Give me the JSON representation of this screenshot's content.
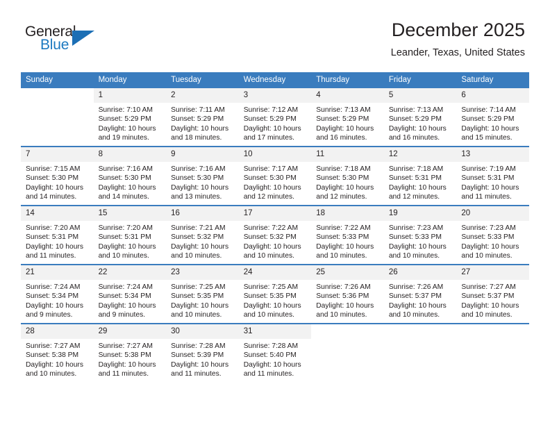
{
  "brand": {
    "name_part1": "General",
    "name_part2": "Blue",
    "accent_color": "#1c79c0"
  },
  "header": {
    "month_title": "December 2025",
    "location": "Leander, Texas, United States"
  },
  "calendar": {
    "header_background": "#3a7cbe",
    "daynum_background": "#f2f2f2",
    "weekdays": [
      "Sunday",
      "Monday",
      "Tuesday",
      "Wednesday",
      "Thursday",
      "Friday",
      "Saturday"
    ],
    "weeks": [
      [
        {
          "day": "",
          "sunrise": "",
          "sunset": "",
          "daylight_line1": "",
          "daylight_line2": ""
        },
        {
          "day": "1",
          "sunrise": "Sunrise: 7:10 AM",
          "sunset": "Sunset: 5:29 PM",
          "daylight_line1": "Daylight: 10 hours",
          "daylight_line2": "and 19 minutes."
        },
        {
          "day": "2",
          "sunrise": "Sunrise: 7:11 AM",
          "sunset": "Sunset: 5:29 PM",
          "daylight_line1": "Daylight: 10 hours",
          "daylight_line2": "and 18 minutes."
        },
        {
          "day": "3",
          "sunrise": "Sunrise: 7:12 AM",
          "sunset": "Sunset: 5:29 PM",
          "daylight_line1": "Daylight: 10 hours",
          "daylight_line2": "and 17 minutes."
        },
        {
          "day": "4",
          "sunrise": "Sunrise: 7:13 AM",
          "sunset": "Sunset: 5:29 PM",
          "daylight_line1": "Daylight: 10 hours",
          "daylight_line2": "and 16 minutes."
        },
        {
          "day": "5",
          "sunrise": "Sunrise: 7:13 AM",
          "sunset": "Sunset: 5:29 PM",
          "daylight_line1": "Daylight: 10 hours",
          "daylight_line2": "and 16 minutes."
        },
        {
          "day": "6",
          "sunrise": "Sunrise: 7:14 AM",
          "sunset": "Sunset: 5:29 PM",
          "daylight_line1": "Daylight: 10 hours",
          "daylight_line2": "and 15 minutes."
        }
      ],
      [
        {
          "day": "7",
          "sunrise": "Sunrise: 7:15 AM",
          "sunset": "Sunset: 5:30 PM",
          "daylight_line1": "Daylight: 10 hours",
          "daylight_line2": "and 14 minutes."
        },
        {
          "day": "8",
          "sunrise": "Sunrise: 7:16 AM",
          "sunset": "Sunset: 5:30 PM",
          "daylight_line1": "Daylight: 10 hours",
          "daylight_line2": "and 14 minutes."
        },
        {
          "day": "9",
          "sunrise": "Sunrise: 7:16 AM",
          "sunset": "Sunset: 5:30 PM",
          "daylight_line1": "Daylight: 10 hours",
          "daylight_line2": "and 13 minutes."
        },
        {
          "day": "10",
          "sunrise": "Sunrise: 7:17 AM",
          "sunset": "Sunset: 5:30 PM",
          "daylight_line1": "Daylight: 10 hours",
          "daylight_line2": "and 12 minutes."
        },
        {
          "day": "11",
          "sunrise": "Sunrise: 7:18 AM",
          "sunset": "Sunset: 5:30 PM",
          "daylight_line1": "Daylight: 10 hours",
          "daylight_line2": "and 12 minutes."
        },
        {
          "day": "12",
          "sunrise": "Sunrise: 7:18 AM",
          "sunset": "Sunset: 5:31 PM",
          "daylight_line1": "Daylight: 10 hours",
          "daylight_line2": "and 12 minutes."
        },
        {
          "day": "13",
          "sunrise": "Sunrise: 7:19 AM",
          "sunset": "Sunset: 5:31 PM",
          "daylight_line1": "Daylight: 10 hours",
          "daylight_line2": "and 11 minutes."
        }
      ],
      [
        {
          "day": "14",
          "sunrise": "Sunrise: 7:20 AM",
          "sunset": "Sunset: 5:31 PM",
          "daylight_line1": "Daylight: 10 hours",
          "daylight_line2": "and 11 minutes."
        },
        {
          "day": "15",
          "sunrise": "Sunrise: 7:20 AM",
          "sunset": "Sunset: 5:31 PM",
          "daylight_line1": "Daylight: 10 hours",
          "daylight_line2": "and 10 minutes."
        },
        {
          "day": "16",
          "sunrise": "Sunrise: 7:21 AM",
          "sunset": "Sunset: 5:32 PM",
          "daylight_line1": "Daylight: 10 hours",
          "daylight_line2": "and 10 minutes."
        },
        {
          "day": "17",
          "sunrise": "Sunrise: 7:22 AM",
          "sunset": "Sunset: 5:32 PM",
          "daylight_line1": "Daylight: 10 hours",
          "daylight_line2": "and 10 minutes."
        },
        {
          "day": "18",
          "sunrise": "Sunrise: 7:22 AM",
          "sunset": "Sunset: 5:33 PM",
          "daylight_line1": "Daylight: 10 hours",
          "daylight_line2": "and 10 minutes."
        },
        {
          "day": "19",
          "sunrise": "Sunrise: 7:23 AM",
          "sunset": "Sunset: 5:33 PM",
          "daylight_line1": "Daylight: 10 hours",
          "daylight_line2": "and 10 minutes."
        },
        {
          "day": "20",
          "sunrise": "Sunrise: 7:23 AM",
          "sunset": "Sunset: 5:33 PM",
          "daylight_line1": "Daylight: 10 hours",
          "daylight_line2": "and 10 minutes."
        }
      ],
      [
        {
          "day": "21",
          "sunrise": "Sunrise: 7:24 AM",
          "sunset": "Sunset: 5:34 PM",
          "daylight_line1": "Daylight: 10 hours",
          "daylight_line2": "and 9 minutes."
        },
        {
          "day": "22",
          "sunrise": "Sunrise: 7:24 AM",
          "sunset": "Sunset: 5:34 PM",
          "daylight_line1": "Daylight: 10 hours",
          "daylight_line2": "and 9 minutes."
        },
        {
          "day": "23",
          "sunrise": "Sunrise: 7:25 AM",
          "sunset": "Sunset: 5:35 PM",
          "daylight_line1": "Daylight: 10 hours",
          "daylight_line2": "and 10 minutes."
        },
        {
          "day": "24",
          "sunrise": "Sunrise: 7:25 AM",
          "sunset": "Sunset: 5:35 PM",
          "daylight_line1": "Daylight: 10 hours",
          "daylight_line2": "and 10 minutes."
        },
        {
          "day": "25",
          "sunrise": "Sunrise: 7:26 AM",
          "sunset": "Sunset: 5:36 PM",
          "daylight_line1": "Daylight: 10 hours",
          "daylight_line2": "and 10 minutes."
        },
        {
          "day": "26",
          "sunrise": "Sunrise: 7:26 AM",
          "sunset": "Sunset: 5:37 PM",
          "daylight_line1": "Daylight: 10 hours",
          "daylight_line2": "and 10 minutes."
        },
        {
          "day": "27",
          "sunrise": "Sunrise: 7:27 AM",
          "sunset": "Sunset: 5:37 PM",
          "daylight_line1": "Daylight: 10 hours",
          "daylight_line2": "and 10 minutes."
        }
      ],
      [
        {
          "day": "28",
          "sunrise": "Sunrise: 7:27 AM",
          "sunset": "Sunset: 5:38 PM",
          "daylight_line1": "Daylight: 10 hours",
          "daylight_line2": "and 10 minutes."
        },
        {
          "day": "29",
          "sunrise": "Sunrise: 7:27 AM",
          "sunset": "Sunset: 5:38 PM",
          "daylight_line1": "Daylight: 10 hours",
          "daylight_line2": "and 11 minutes."
        },
        {
          "day": "30",
          "sunrise": "Sunrise: 7:28 AM",
          "sunset": "Sunset: 5:39 PM",
          "daylight_line1": "Daylight: 10 hours",
          "daylight_line2": "and 11 minutes."
        },
        {
          "day": "31",
          "sunrise": "Sunrise: 7:28 AM",
          "sunset": "Sunset: 5:40 PM",
          "daylight_line1": "Daylight: 10 hours",
          "daylight_line2": "and 11 minutes."
        },
        {
          "day": "",
          "sunrise": "",
          "sunset": "",
          "daylight_line1": "",
          "daylight_line2": ""
        },
        {
          "day": "",
          "sunrise": "",
          "sunset": "",
          "daylight_line1": "",
          "daylight_line2": ""
        },
        {
          "day": "",
          "sunrise": "",
          "sunset": "",
          "daylight_line1": "",
          "daylight_line2": ""
        }
      ]
    ]
  }
}
